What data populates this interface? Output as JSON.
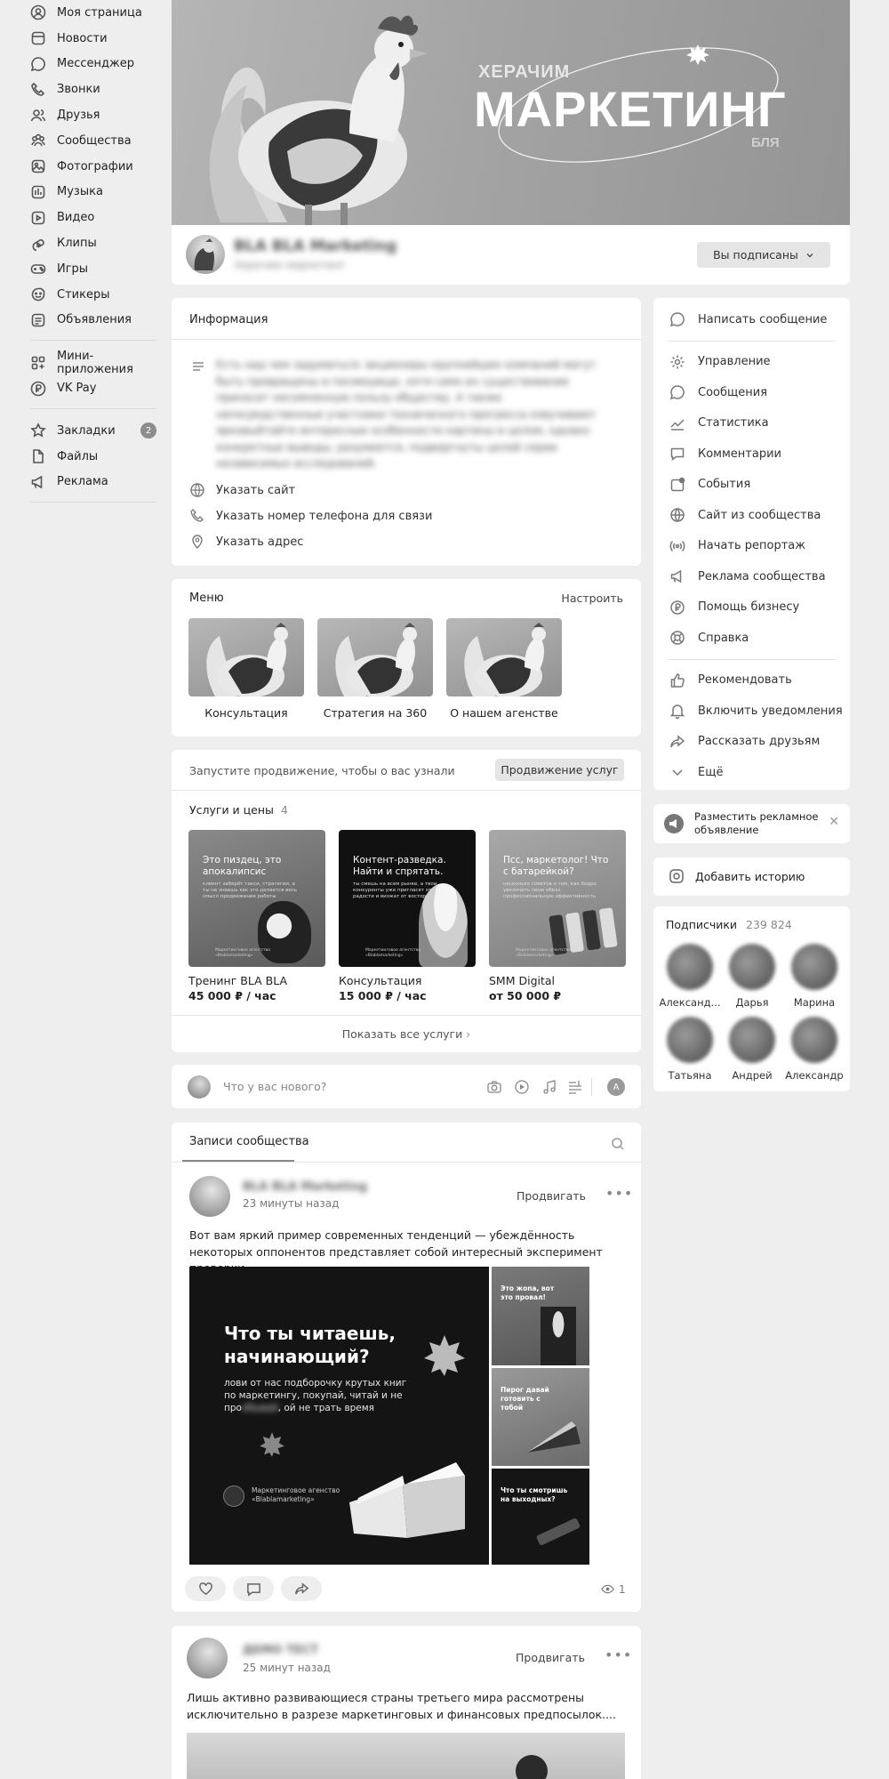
{
  "sidebar": {
    "items": [
      {
        "label": "Моя страница",
        "icon": "user-circle-icon"
      },
      {
        "label": "Новости",
        "icon": "news-icon"
      },
      {
        "label": "Мессенджер",
        "icon": "chat-icon"
      },
      {
        "label": "Звонки",
        "icon": "phone-icon"
      },
      {
        "label": "Друзья",
        "icon": "friends-icon"
      },
      {
        "label": "Сообщества",
        "icon": "communities-icon"
      },
      {
        "label": "Фотографии",
        "icon": "photo-icon"
      },
      {
        "label": "Музыка",
        "icon": "music-icon"
      },
      {
        "label": "Видео",
        "icon": "video-icon"
      },
      {
        "label": "Клипы",
        "icon": "clips-icon"
      },
      {
        "label": "Игры",
        "icon": "gamepad-icon"
      },
      {
        "label": "Стикеры",
        "icon": "sticker-icon"
      },
      {
        "label": "Объявления",
        "icon": "ads-icon"
      }
    ],
    "items2": [
      {
        "label": "Мини-приложения",
        "icon": "apps-icon"
      },
      {
        "label": "VK Pay",
        "icon": "vkpay-icon"
      }
    ],
    "items3": [
      {
        "label": "Закладки",
        "icon": "star-icon",
        "badge": "2"
      },
      {
        "label": "Файлы",
        "icon": "file-icon"
      },
      {
        "label": "Реклама",
        "icon": "megaphone-icon"
      }
    ]
  },
  "cover": {
    "top_word": "ХЕРАЧИМ",
    "big_word": "МАРКЕТИНГ",
    "bottom_word": "БЛЯ"
  },
  "profile": {
    "name": "BLA BLA Marketing",
    "status": "Херачим маркетинг",
    "subscribed_button": "Вы подписаны"
  },
  "info": {
    "title": "Информация",
    "description": "Есть над чем задуматься: акционеры крупнейших компаний могут быть превращены в посмешище, хотя само их существование приносит несомненную пользу обществу. А также непосредственные участники технического прогресса озвучивают ярковыйтайте интересные особенности картины в целом, однако конкретные выводы, разумеется, подвергнуты целой серии независимых исследований.",
    "site": "Указать сайт",
    "phone": "Указать номер телефона для связи",
    "address": "Указать адрес"
  },
  "menu": {
    "title": "Меню",
    "configure": "Настроить",
    "items": [
      "Консультация",
      "Стратегия на 360",
      "О нашем агенстве"
    ]
  },
  "promo": {
    "text": "Запустите продвижение, чтобы о вас узнали",
    "button": "Продвижение услуг"
  },
  "services": {
    "title": "Услуги и цены",
    "count": "4",
    "items": [
      {
        "thumb_title": "Это пиздец, это апокалипсис",
        "thumb_text": "клиент заберёт такси, стратегии, а ты не знаешь как это делается весь смысл продвижения работы",
        "name": "Тренинг BLA BLA",
        "price": "45 000 ₽ / час"
      },
      {
        "thumb_title": "Контент-разведка. Найти и спрятать.",
        "thumb_text": "ты смешь на всем рынке, а твои конкуренты уже пригласят от радости и визжат от восторга",
        "name": "Консультация",
        "price": "15 000 ₽ / час"
      },
      {
        "thumb_title": "Псс, маркетолог! Что с батарейкой?",
        "thumb_text": "несколько советов о том, как бодро увеличить свою образ профессиональную эффективность",
        "name": "SMM Digital",
        "price": "от 50 000 ₽"
      }
    ],
    "thumb_caption": "Маркетинговое агентство «Blablamarketing»",
    "show_all": "Показать все услуги"
  },
  "composer": {
    "placeholder": "Что у вас нового?",
    "avatar_letter": "A"
  },
  "wall": {
    "tab": "Записи сообщества"
  },
  "post1": {
    "author": "BLA BLA Marketing",
    "time": "23 минуты назад",
    "promote": "Продвигать",
    "text": "Вот вам яркий пример современных тенденций — убеждённость некоторых оппонентов представляет собой интересный эксперимент проверки...",
    "main_title": "Что ты читаешь, начинающий?",
    "main_sub": "лови от нас подборочку крутых книг по маркетингу, покупай, читай и не про",
    "main_sub_blur": "ебывай",
    "main_sub_end": ", ой не трать время",
    "agency_caption": "Маркетинговое агенство «Blablamarketing»",
    "side1_title": "Это жопа, вот это провал!",
    "side2_title": "Пирог давай готовить с тобой",
    "side3_title": "Что ты смотришь на выходных?",
    "views": "1"
  },
  "post2": {
    "author": "ДЕМО ТЕСТ",
    "time": "25 минут назад",
    "promote": "Продвигать",
    "text": "Лишь активно развивающиеся страны третьего мира рассмотрены исключительно в разрезе маркетинговых и финансовых предпосылок...."
  },
  "right_panel": {
    "write": "Написать сообщение",
    "items1": [
      "Управление",
      "Сообщения",
      "Статистика",
      "Комментарии",
      "События",
      "Сайт из сообщества",
      "Начать репортаж",
      "Реклама сообщества",
      "Помощь бизнесу",
      "Справка"
    ],
    "icons1": [
      "gear-icon",
      "message-icon",
      "stats-icon",
      "comment-icon",
      "event-icon",
      "globe-icon",
      "live-icon",
      "megaphone-icon",
      "ruble-icon",
      "lifebuoy-icon"
    ],
    "items2": [
      "Рекомендовать",
      "Включить уведомления",
      "Рассказать друзьям",
      "Ещё"
    ],
    "icons2": [
      "thumbs-up-icon",
      "bell-icon",
      "share-icon",
      "chevron-down-icon"
    ],
    "ad_text": "Разместить рекламное объявление",
    "story": "Добавить историю",
    "subscribers_title": "Подписчики",
    "subscribers_count": "239 824",
    "subscribers": [
      "Александ...",
      "Дарья",
      "Марина",
      "Татьяна",
      "Андрей",
      "Александр"
    ]
  }
}
